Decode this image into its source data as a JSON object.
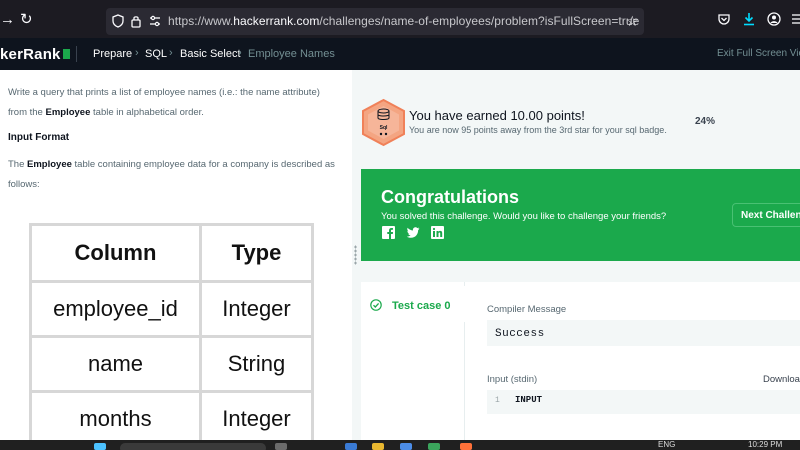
{
  "browser": {
    "url_prefix": "https://www.",
    "url_host": "hackerrank.com",
    "url_path": "/challenges/name-of-employees/problem?isFullScreen=true"
  },
  "header": {
    "brand": "kerRank",
    "breadcrumbs": [
      "Prepare",
      "SQL",
      "Basic Select",
      "Employee Names"
    ],
    "exit_fullscreen": "Exit Full Screen View"
  },
  "problem": {
    "intro_parts": [
      "Write a query that prints a list of employee names (i.e.: the name attribute) from the ",
      "Employee",
      " table in alphabetical order."
    ],
    "input_heading": "Input Format",
    "format_parts": [
      "The ",
      "Employee",
      " table containing employee data for a company is described as follows:"
    ],
    "table": {
      "headers": [
        "Column",
        "Type"
      ],
      "rows": [
        [
          "employee_id",
          "Integer"
        ],
        [
          "name",
          "String"
        ],
        [
          "months",
          "Integer"
        ]
      ]
    }
  },
  "points": {
    "badge_label": "Sql",
    "title": "You have earned 10.00 points!",
    "subtitle": "You are now 95 points away from the 3rd star for your sql badge.",
    "progress_text": "24%",
    "progress": 0.24
  },
  "congrats": {
    "title": "Congratulations",
    "subtitle": "You solved this challenge. Would you like to challenge your friends?",
    "next_button": "Next Challenge"
  },
  "testcase": {
    "tab_label": "Test case 0",
    "compiler_label": "Compiler Message",
    "compiler_value": "Success",
    "stdin_label": "Input (stdin)",
    "stdin_line_no": "1",
    "stdin_value": "INPUT",
    "download_label": "Download"
  },
  "taskbar": {
    "lang": "ENG",
    "time": "10:29 PM"
  },
  "colors": {
    "brand_green": "#1ba94c",
    "header_dark": "#0e141e",
    "badge_orange": "#f4a582"
  }
}
